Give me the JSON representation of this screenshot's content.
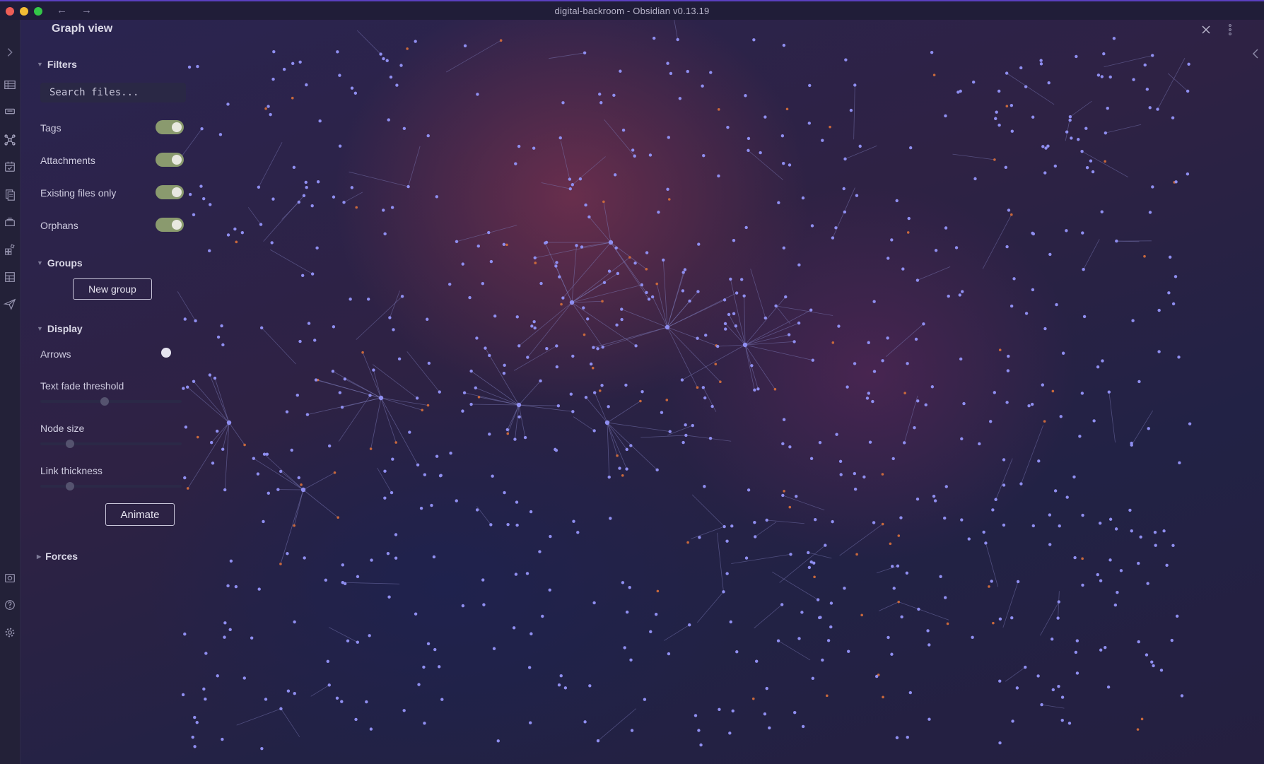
{
  "window": {
    "title": "digital-backroom - Obsidian v0.13.19",
    "back_arrow": "←",
    "forward_arrow": "→"
  },
  "ribbon": {
    "icons": [
      "chevron-right-icon",
      "table-icon",
      "tag-icon",
      "graph-icon",
      "calendar-check-icon",
      "files-icon",
      "cards-icon",
      "plugin-grid-icon",
      "layout-icon",
      "send-icon",
      "vault-icon",
      "help-icon",
      "settings-icon"
    ]
  },
  "header": {
    "title": "Graph view"
  },
  "filters": {
    "heading": "Filters",
    "search_placeholder": "Search files...",
    "options": [
      {
        "label": "Tags",
        "on": true
      },
      {
        "label": "Attachments",
        "on": true
      },
      {
        "label": "Existing files only",
        "on": true
      },
      {
        "label": "Orphans",
        "on": true
      }
    ]
  },
  "groups": {
    "heading": "Groups",
    "new_group_label": "New group"
  },
  "display": {
    "heading": "Display",
    "arrows_label": "Arrows",
    "arrows_on": false,
    "text_fade_label": "Text fade threshold",
    "text_fade_value": 0.45,
    "node_size_label": "Node size",
    "node_size_value": 0.19,
    "link_thickness_label": "Link thickness",
    "link_thickness_value": 0.19,
    "animate_label": "Animate"
  },
  "forces": {
    "heading": "Forces"
  },
  "graph": {
    "node_color": "#8f8ef0",
    "attachment_node_color": "#c8683c",
    "link_color": "#7c7ab8",
    "background_accent": "#7a3250"
  }
}
